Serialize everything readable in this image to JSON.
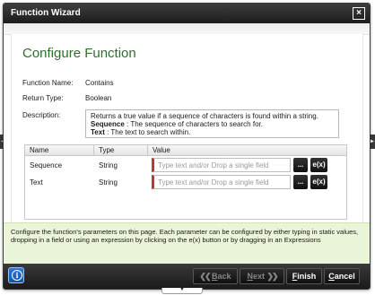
{
  "window": {
    "title": "Function Wizard",
    "close_glyph": "×"
  },
  "page": {
    "heading": "Configure Function"
  },
  "fields": {
    "name_label": "Function Name:",
    "name_value": "Contains",
    "return_label": "Return Type:",
    "return_value": "Boolean",
    "description_label": "Description:",
    "description": {
      "line1": "Returns a true value if a sequence of characters is found within a string.",
      "line2_term": "Sequence",
      "line2_rest": " : The sequence of characters to search for.",
      "line3_term": "Text",
      "line3_rest": " : The text to search within."
    }
  },
  "grid": {
    "columns": [
      "Name",
      "Type",
      "Value"
    ],
    "rows": [
      {
        "name": "Sequence",
        "type": "String",
        "value": "",
        "placeholder": "Type text and/or Drop a single field"
      },
      {
        "name": "Text",
        "type": "String",
        "value": "",
        "placeholder": "Type text and/or Drop a single field"
      }
    ],
    "dots_label": "...",
    "expr_label": "e(x)"
  },
  "info": {
    "text": "Configure the function's parameters on this page. Each parameter can be configured by either typing in static values, dropping in a field or using an expression by clicking on the e(x) button or by dragging in an Expressions"
  },
  "footer": {
    "info_glyph": "i",
    "back_prefix": "B",
    "back_rest": "ack",
    "next_prefix": "N",
    "next_rest": "ext",
    "finish_prefix": "F",
    "finish_rest": "inish",
    "cancel_prefix": "C",
    "cancel_rest": "ancel"
  },
  "icons": {
    "left_tab": "caret-left-icon",
    "right_tab": "caret-right-icon",
    "bottom_handle": "caret-down-icon"
  },
  "colors": {
    "heading_green": "#2f6e2f",
    "info_panel_bg": "#e9f4d9",
    "required_marker": "#c0392b",
    "info_button_blue": "#1f6ac6"
  }
}
